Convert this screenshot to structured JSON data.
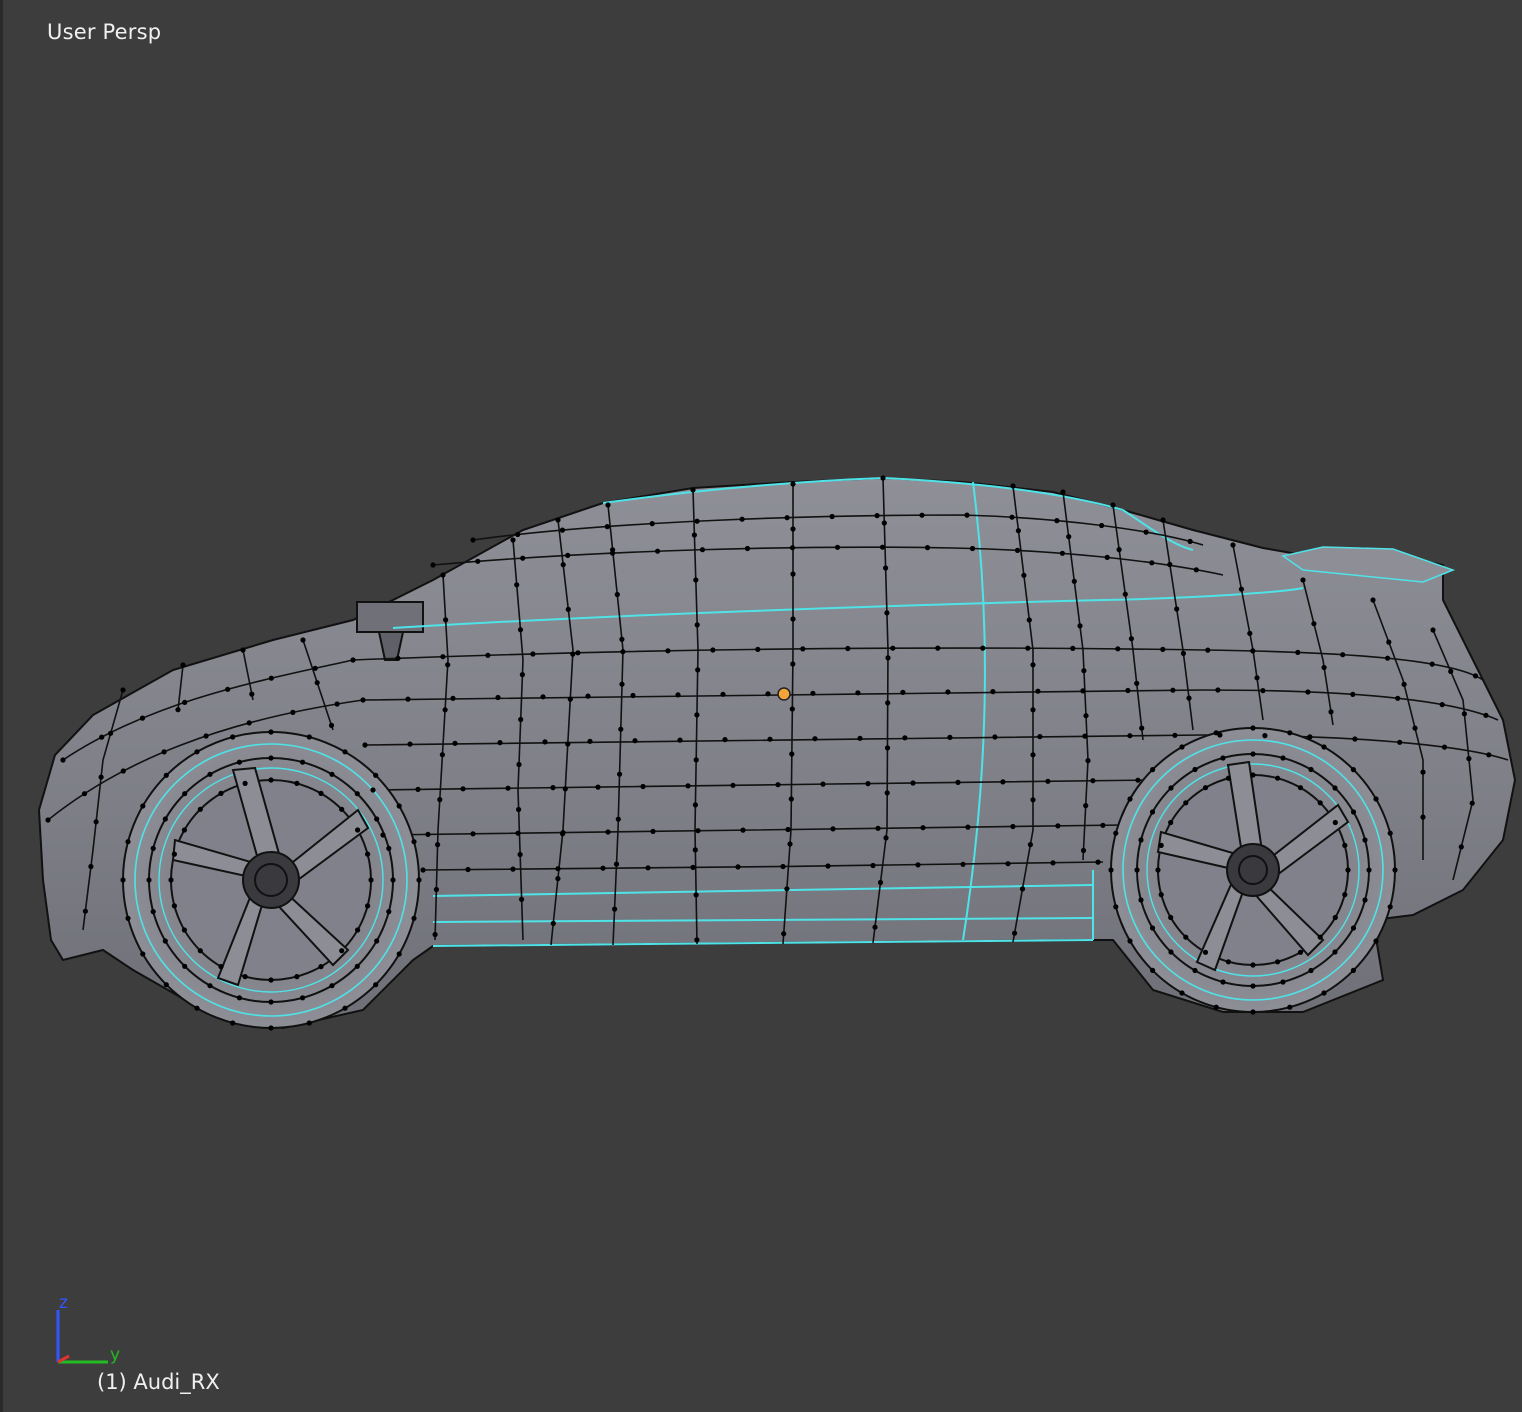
{
  "viewport": {
    "view_label": "User Persp",
    "object_label": "(1) Audi_RX",
    "axes": {
      "z": "z",
      "y": "y"
    }
  },
  "colors": {
    "background": "#3d3d3d",
    "mesh_face": "#8a8b93",
    "mesh_edge": "#111111",
    "seam_edge": "#4fe3e8",
    "origin": "#f3a53a",
    "axis_z": "#3355ff",
    "axis_y": "#22bb22",
    "axis_x": "#dd3333"
  },
  "icons": [
    "origin-point-icon",
    "axis-gizmo-icon"
  ]
}
